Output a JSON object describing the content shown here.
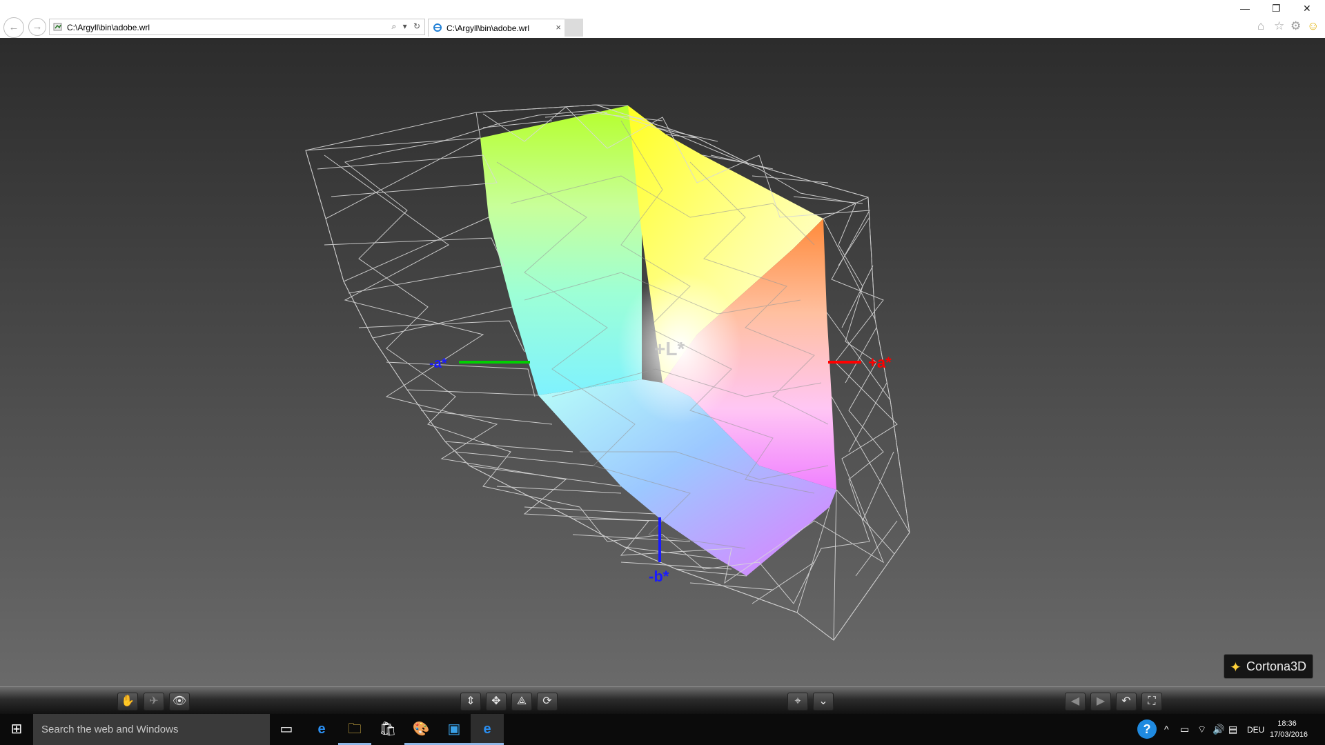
{
  "browser": {
    "address": "C:\\Argyll\\bin\\adobe.wrl",
    "tab_title": "C:\\Argyll\\bin\\adobe.wrl",
    "tab_close": "×",
    "back": "←",
    "forward": "→",
    "search_glyph": "⌕",
    "dropdown_glyph": "▾",
    "refresh_glyph": "↻",
    "window": {
      "minimize": "—",
      "restore": "❐",
      "close": "✕"
    },
    "icons": {
      "home": "⌂",
      "favorites": "☆",
      "settings": "⚙",
      "smiley": "☺"
    }
  },
  "viewer": {
    "axes": {
      "plus_l": "+L*",
      "plus_a": "+a*",
      "minus_a": "-a*",
      "minus_b": "-b*"
    },
    "colors": {
      "plus_a": "#ff0000",
      "minus_a": "#00d000",
      "minus_b": "#1a1aff",
      "wire": "#d8d8d8"
    },
    "logo": {
      "mark": "✦",
      "text": "Cortona3D"
    }
  },
  "toolbar": {
    "left": [
      {
        "icon": "pan-hand-icon",
        "glyph": "✋"
      },
      {
        "icon": "fly-plane-icon",
        "glyph": "✈"
      },
      {
        "icon": "study-eye-icon",
        "glyph": "👁"
      }
    ],
    "center": [
      {
        "icon": "elevate-arrow-icon",
        "glyph": "⇕"
      },
      {
        "icon": "plane-move-icon",
        "glyph": "✥"
      },
      {
        "icon": "tilt-icon",
        "glyph": "⟁"
      },
      {
        "icon": "rotate-icon",
        "glyph": "⟳"
      }
    ],
    "right_center": [
      {
        "icon": "align-target-icon",
        "glyph": "⌖"
      },
      {
        "icon": "straighten-icon",
        "glyph": "⌄"
      }
    ],
    "right": [
      {
        "icon": "prev-viewpoint-icon",
        "glyph": "◀"
      },
      {
        "icon": "next-viewpoint-icon",
        "glyph": "▶"
      },
      {
        "icon": "restore-view-icon",
        "glyph": "↶"
      },
      {
        "icon": "fit-view-icon",
        "glyph": "⛶"
      }
    ]
  },
  "taskbar": {
    "search_placeholder": "Search the web and Windows",
    "start_glyph": "⊞",
    "apps": [
      {
        "icon": "task-view-icon",
        "glyph": "▭"
      },
      {
        "icon": "edge-icon",
        "glyph": "e"
      },
      {
        "icon": "file-explorer-icon",
        "glyph": "🗀"
      },
      {
        "icon": "store-icon",
        "glyph": "🛍"
      },
      {
        "icon": "paint-icon",
        "glyph": "🎨"
      },
      {
        "icon": "app-window-icon",
        "glyph": "▣"
      },
      {
        "icon": "internet-explorer-icon",
        "glyph": "e"
      }
    ],
    "tray": {
      "help": "?",
      "chevron": "^",
      "battery": "▭",
      "network": "⌔",
      "volume": "🔊",
      "notifications": "▤",
      "language": "DEU"
    },
    "time": "18:36",
    "date": "17/03/2016"
  }
}
